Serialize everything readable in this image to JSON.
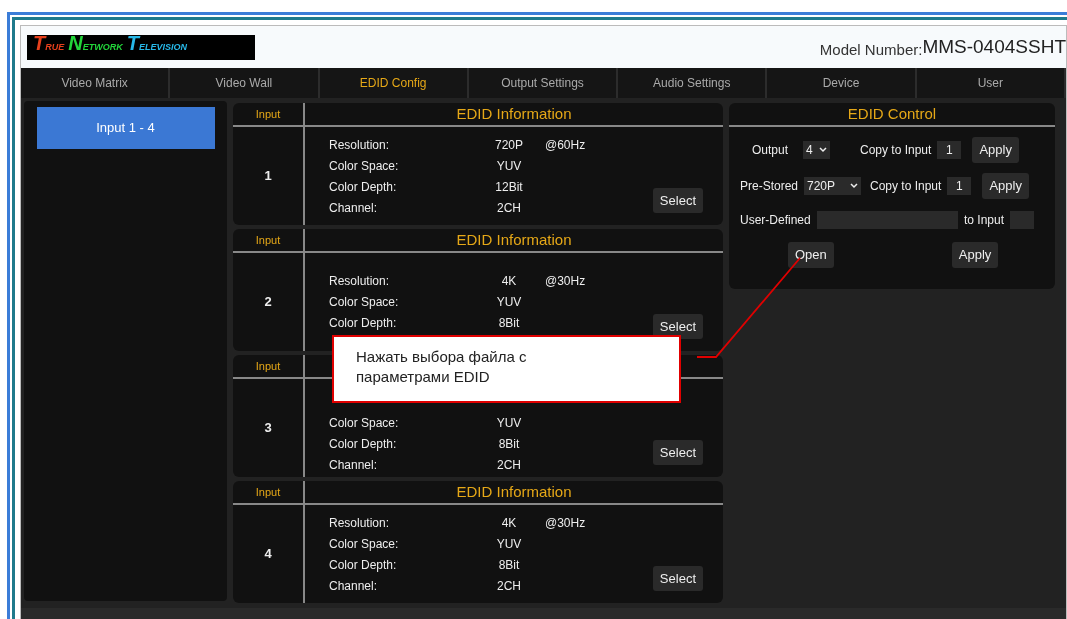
{
  "logo": [
    {
      "initial": "T",
      "rest": "RUE",
      "color": "#e8401c"
    },
    {
      "initial": "N",
      "rest": "ETWORK",
      "color": "#22d63a"
    },
    {
      "initial": "T",
      "rest": "ELEVISION",
      "color": "#27b8e8"
    }
  ],
  "model": {
    "label": "Model Number:",
    "value": "MMS-0404SSHT"
  },
  "tabs": [
    {
      "label": "Video Matrix",
      "selected": false
    },
    {
      "label": "Video Wall",
      "selected": false
    },
    {
      "label": "EDID Config",
      "selected": true
    },
    {
      "label": "Output Settings",
      "selected": false
    },
    {
      "label": "Audio Settings",
      "selected": false
    },
    {
      "label": "Device",
      "selected": false
    },
    {
      "label": "User",
      "selected": false
    }
  ],
  "sidebar": {
    "items": [
      {
        "label": "Input 1 - 4",
        "selected": true
      }
    ]
  },
  "inputs": [
    {
      "header": "Input",
      "title": "EDID Information",
      "number": "1",
      "button": "Select",
      "rows": [
        {
          "label": "Resolution:",
          "value": "720P",
          "rate": "@60Hz"
        },
        {
          "label": "Color Space:",
          "value": "YUV"
        },
        {
          "label": "Color Depth:",
          "value": "12Bit"
        },
        {
          "label": "Channel:",
          "value": "2CH"
        }
      ]
    },
    {
      "header": "Input",
      "title": "EDID Information",
      "number": "2",
      "button": "Select",
      "rows": [
        {
          "label": "Resolution:",
          "value": "4K",
          "rate": "@30Hz"
        },
        {
          "label": "Color Space:",
          "value": "YUV"
        },
        {
          "label": "Color Depth:",
          "value": "8Bit"
        }
      ]
    },
    {
      "header": "Input",
      "number": "3",
      "button": "Select",
      "rows": [
        {
          "label": "Color Space:",
          "value": "YUV"
        },
        {
          "label": "Color Depth:",
          "value": "8Bit"
        },
        {
          "label": "Channel:",
          "value": "2CH"
        }
      ]
    },
    {
      "header": "Input",
      "title": "EDID Information",
      "number": "4",
      "button": "Select",
      "rows": [
        {
          "label": "Resolution:",
          "value": "4K",
          "rate": "@30Hz"
        },
        {
          "label": "Color Space:",
          "value": "YUV"
        },
        {
          "label": "Color Depth:",
          "value": "8Bit"
        },
        {
          "label": "Channel:",
          "value": "2CH"
        }
      ]
    }
  ],
  "control": {
    "title": "EDID Control",
    "output_row": {
      "label": "Output",
      "select": "4",
      "copy_label": "Copy to Input",
      "copy_value": "1",
      "button": "Apply"
    },
    "prestored_row": {
      "label": "Pre-Stored",
      "select": "720P",
      "copy_label": "Copy to Input",
      "copy_value": "1",
      "button": "Apply"
    },
    "user_row": {
      "label": "User-Defined",
      "to_label": "to Input"
    },
    "buttons": [
      "Open",
      "Apply"
    ]
  },
  "callout": {
    "text": "Нажать выбора файла с параметрами EDID"
  }
}
